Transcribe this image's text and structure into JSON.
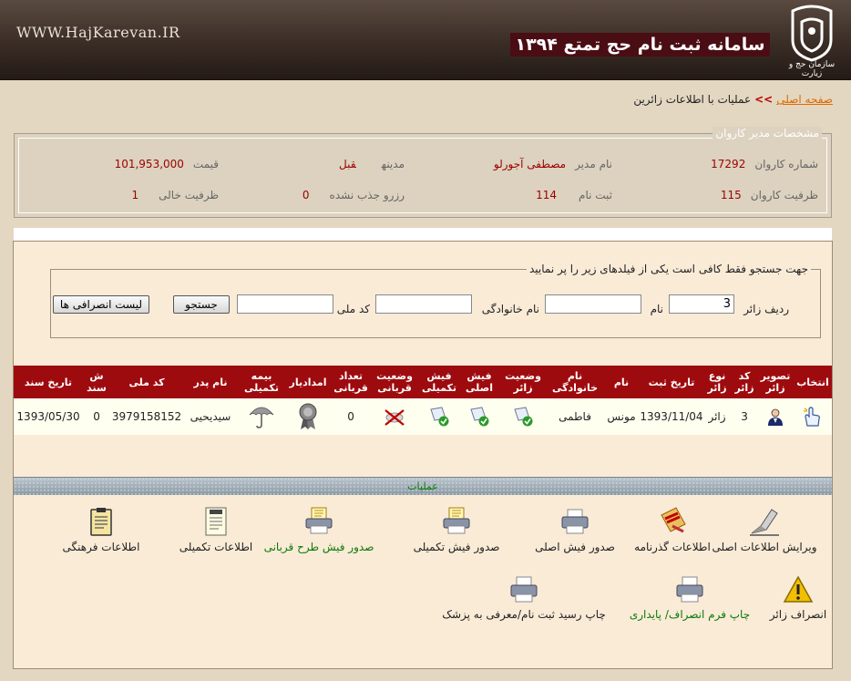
{
  "header": {
    "site_url": "WWW.HajKarevan.IR",
    "title": "سامانه ثبت نام حج تمتع ۱۳۹۴",
    "logo_caption": "سازمان حج و زیارت"
  },
  "breadcrumb": {
    "home": "صفحه اصلی",
    "sep": ">>",
    "current": "عملیات با اطلاعات زائرین"
  },
  "manager": {
    "legend": "مشخصات مدیر کاروان",
    "fields": [
      {
        "label": "شماره کاروان",
        "value": "17292"
      },
      {
        "label": "نام مدیر",
        "value": "مصطفی آجورلو"
      },
      {
        "label": "مدینه",
        "value": "قبل"
      },
      {
        "label": "قیمت",
        "value": "101,953,000"
      },
      {
        "label": "ظرفیت کاروان",
        "value": "115"
      },
      {
        "label": "ثبت نام",
        "value": "114"
      },
      {
        "label": "رزرو جذب نشده",
        "value": "0"
      },
      {
        "label": "ظرفیت خالی",
        "value": "1"
      }
    ]
  },
  "search": {
    "legend": "جهت جستجو فقط کافی است یکی از فیلدهای زیر را پر نمایید",
    "row_label": "ردیف زائر",
    "row_value": "3",
    "name_label": "نام",
    "name_value": "",
    "family_label": "نام خانوادگی",
    "family_value": "",
    "national_label": "کد ملی",
    "national_value": "",
    "search_btn": "جستجو",
    "cancel_list_btn": "لیست انصرافی ها"
  },
  "table": {
    "headers": {
      "select": "انتخاب",
      "photo": "تصویر زائر",
      "code": "کد زائر",
      "type": "نوع زائر",
      "reg_date": "تاریخ ثبت",
      "name": "نام",
      "family": "نام خانوادگی",
      "status": "وضعیت زائر",
      "main_slip": "فیش اصلی",
      "extra_slip": "فیش تکمیلی",
      "sacrifice_status": "وضعیت قربانی",
      "sacrifice_count": "تعداد قربانی",
      "emdad": "امدادیار",
      "insurance": "بیمه تکمیلی",
      "father": "نام پدر",
      "national_code": "کد ملی",
      "doc_no": "ش سند",
      "doc_date": "تاریخ سند"
    },
    "row": {
      "code": "3",
      "type": "زائر",
      "reg_date": "1393/11/04",
      "name": "مونس",
      "family": "فاطمی",
      "sacrifice_count": "0",
      "father": "سیدیحیی",
      "national_code": "3979158152",
      "doc_no": "0",
      "doc_date": "1393/05/30"
    }
  },
  "operations": {
    "title": "عملیات",
    "items": [
      {
        "label": "ویرایش اطلاعات اصلی"
      },
      {
        "label": "اطلاعات گذرنامه"
      },
      {
        "label": "صدور فیش اصلی"
      },
      {
        "label": "صدور فیش تکمیلی"
      },
      {
        "label": "صدور فیش طرح قربانی"
      },
      {
        "label": "اطلاعات تکمیلی"
      },
      {
        "label": "اطلاعات فرهنگی"
      },
      {
        "label": "انصراف زائر"
      },
      {
        "label": "چاپ فرم انصراف/ پایداری"
      },
      {
        "label": "چاپ رسید ثبت نام/معرفی به پزشک"
      }
    ]
  }
}
